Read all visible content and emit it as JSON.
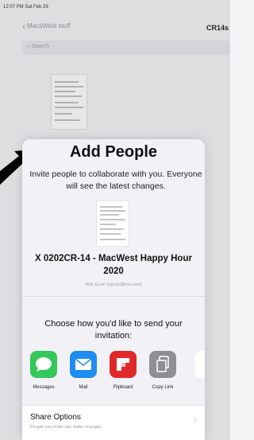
{
  "status_bar": {
    "time": "12:07 PM  Sat Feb 29"
  },
  "nav": {
    "back_label": "MacsWest stuff",
    "title": "CR14s"
  },
  "search": {
    "placeholder": "Search"
  },
  "sheet": {
    "title": "Add People",
    "description": "Invite people to collaborate with you. Everyone will see the latest changes.",
    "document_title": "X 0202CR-14 - MacWest Happy Hour 2020",
    "owner": "Nick Gruin (ngruin@me.com)",
    "choose_text": "Choose how you'd like to send your invitation:",
    "apps": [
      {
        "label": "Messages",
        "icon": "messages-icon",
        "color": "#34c759"
      },
      {
        "label": "Mail",
        "icon": "mail-icon",
        "color": "#1e8cf0"
      },
      {
        "label": "Flipboard",
        "icon": "flipboard-icon",
        "color": "#e12828"
      },
      {
        "label": "Copy Link",
        "icon": "copy-link-icon",
        "color": "#8e8e93"
      }
    ],
    "share_options": {
      "title": "Share Options",
      "subtitle": "People you invite can make changes."
    }
  }
}
